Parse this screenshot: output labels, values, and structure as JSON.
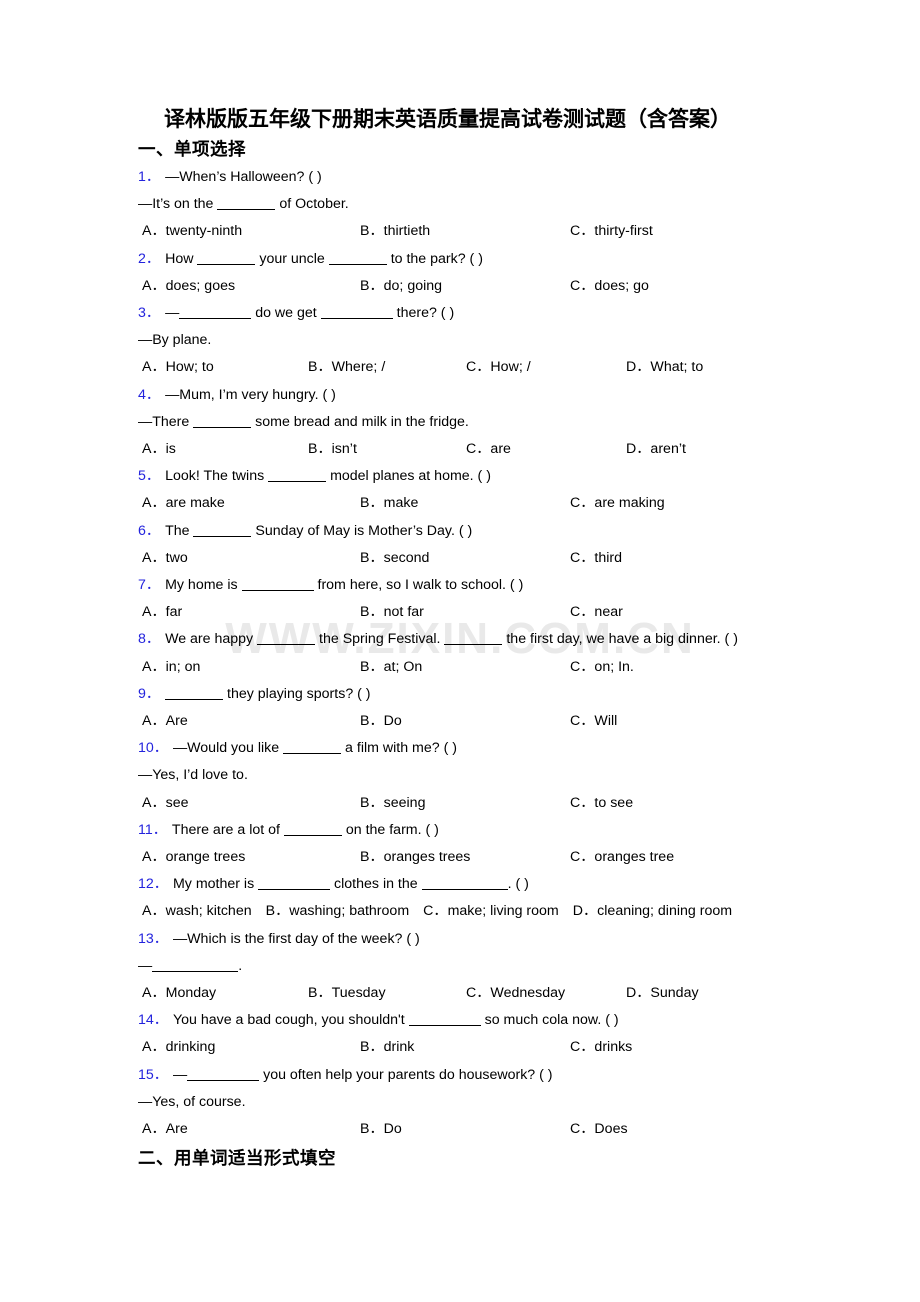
{
  "document": {
    "title": "译林版版五年级下册期末英语质量提高试卷测试题（含答案）",
    "watermark": "WWW.ZIXIN.COM.CN",
    "accent_color": "#2323dd",
    "text_color": "#000000",
    "background_color": "#ffffff"
  },
  "sections": [
    {
      "heading": "一、单项选择"
    },
    {
      "heading": "二、用单词适当形式填空"
    }
  ],
  "questions": [
    {
      "number": "1．",
      "stem_pre": "—When’s Halloween? (",
      "stem_post": ")",
      "lines": [
        "—It’s on the ______ of October."
      ],
      "options": [
        "A．twenty-ninth",
        "B．thirtieth",
        "C．thirty-first"
      ],
      "columns": 3
    },
    {
      "number": "2．",
      "stem": "How ______ your uncle ______ to the park? (   )",
      "options": [
        "A．does; goes",
        "B．do; going",
        "C．does; go"
      ],
      "columns": 3
    },
    {
      "number": "3．",
      "stem": "—________ do we get ________ there? (    )",
      "lines": [
        "—By plane."
      ],
      "options": [
        "A．How; to",
        "B．Where; /",
        "C．How; /",
        "D．What; to"
      ],
      "columns": 4
    },
    {
      "number": "4．",
      "stem": "—Mum, I’m very hungry. (  )",
      "lines": [
        "—There _______ some bread and milk in the fridge."
      ],
      "options": [
        "A．is",
        "B．isn’t",
        "C．are",
        "D．aren’t"
      ],
      "columns": 4
    },
    {
      "number": "5．",
      "stem": "Look! The twins _______ model planes at home. (  )",
      "options": [
        "A．are make",
        "B．make",
        "C．are making"
      ],
      "columns": 3
    },
    {
      "number": "6．",
      "stem": "The _______ Sunday of May is Mother’s Day. (  )",
      "options": [
        "A．two",
        "B．second",
        "C．third"
      ],
      "columns": 3
    },
    {
      "number": "7．",
      "stem": "My home is ________ from here, so I walk to school. (   )",
      "options": [
        "A．far",
        "B．not far",
        "C．near"
      ],
      "columns": 3
    },
    {
      "number": "8．",
      "stem": "We are happy ______ the Spring Festival. ______ the first day, we have a big dinner. (   )",
      "options": [
        "A．in; on",
        "B．at; On",
        "C．on; In."
      ],
      "columns": 3
    },
    {
      "number": "9．",
      "stem": "______ they playing sports? (   )",
      "options": [
        "A．Are",
        "B．Do",
        "C．Will"
      ],
      "columns": 3
    },
    {
      "number": "10．",
      "stem": "—Would you like ______ a film with me? (  )",
      "lines": [
        "—Yes, I’d love to."
      ],
      "options": [
        "A．see",
        "B．seeing",
        "C．to see"
      ],
      "columns": 3
    },
    {
      "number": "11．",
      "stem": "There are a lot of ______ on the farm. (  )",
      "options": [
        "A．orange trees",
        "B．oranges trees",
        "C．oranges tree"
      ],
      "columns": 3
    },
    {
      "number": "12．",
      "stem": "My mother is ________ clothes in the ___________. (  )",
      "options": [
        "A．wash; kitchen",
        "B．washing; bathroom",
        "C．make; living room",
        "D．cleaning; dining room"
      ],
      "columns": "flow"
    },
    {
      "number": "13．",
      "stem": "—Which is the first day of the week? (  )",
      "lines": [
        "—___________."
      ],
      "options": [
        "A．Monday",
        "B．Tuesday",
        "C．Wednesday",
        "D．Sunday"
      ],
      "columns": 4
    },
    {
      "number": "14．",
      "stem": "You have a bad cough, you shouldn't ________ so much cola now. (   )",
      "options": [
        "A．drinking",
        "B．drink",
        "C．drinks"
      ],
      "columns": 3
    },
    {
      "number": "15．",
      "stem": "—________ you often help your parents do housework? (  )",
      "lines": [
        "—Yes, of course."
      ],
      "options": [
        "A．Are",
        "B．Do",
        "C．Does"
      ],
      "columns": 3
    }
  ]
}
